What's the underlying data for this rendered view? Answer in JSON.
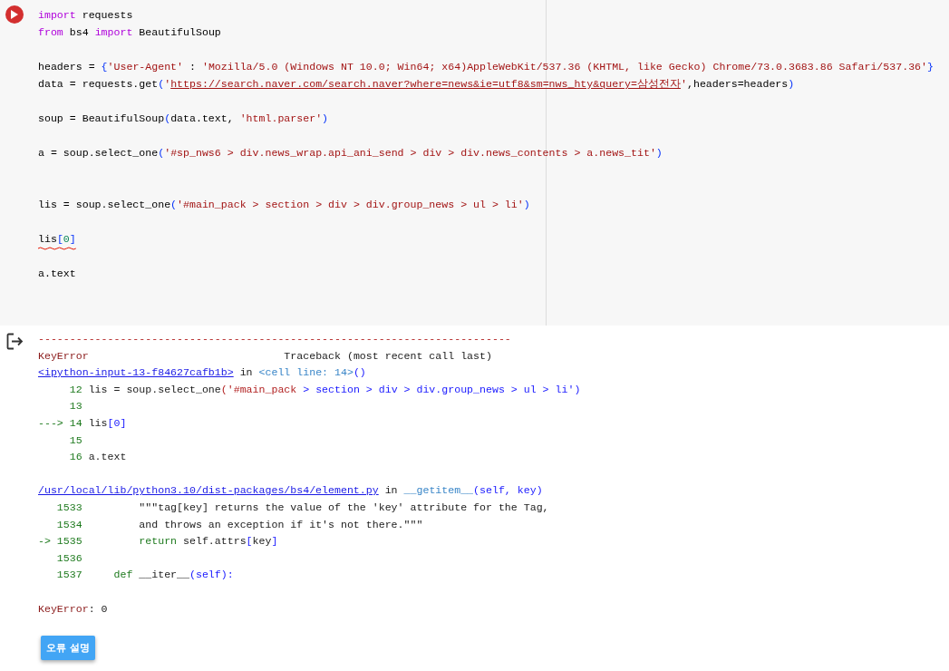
{
  "code_cell": {
    "blocks": [
      {
        "kind": "gap",
        "lines": [
          {
            "error": false,
            "tokens": [
              {
                "kind": "kw",
                "text": "import"
              },
              {
                "kind": "plain",
                "text": " requests"
              }
            ]
          },
          {
            "error": false,
            "tokens": [
              {
                "kind": "kw",
                "text": "from"
              },
              {
                "kind": "plain",
                "text": " bs4 "
              },
              {
                "kind": "kw",
                "text": "import"
              },
              {
                "kind": "plain",
                "text": " BeautifulSoup"
              }
            ]
          }
        ]
      },
      {
        "kind": "gap",
        "lines": [
          {
            "error": false,
            "tokens": [
              {
                "kind": "plain",
                "text": "headers = "
              },
              {
                "kind": "brk",
                "text": "{"
              },
              {
                "kind": "str",
                "text": "'User-Agent'"
              },
              {
                "kind": "plain",
                "text": " : "
              },
              {
                "kind": "str",
                "text": "'Mozilla/5.0 (Windows NT 10.0; Win64; x64)AppleWebKit/537.36 (KHTML, like Gecko) Chrome/73.0.3683.86 Safari/537.36'"
              },
              {
                "kind": "brk",
                "text": "}"
              }
            ]
          },
          {
            "error": false,
            "tokens": [
              {
                "kind": "plain",
                "text": "data = requests.get"
              },
              {
                "kind": "brk",
                "text": "("
              },
              {
                "kind": "str",
                "text": "'"
              },
              {
                "kind": "link",
                "text": "https://search.naver.com/search.naver?where=news&ie=utf8&sm=nws_hty&query=삼성전자"
              },
              {
                "kind": "str",
                "text": "'"
              },
              {
                "kind": "plain",
                "text": ",headers=headers"
              },
              {
                "kind": "brk",
                "text": ")"
              }
            ]
          }
        ]
      },
      {
        "kind": "gap",
        "lines": [
          {
            "error": false,
            "tokens": [
              {
                "kind": "plain",
                "text": "soup = BeautifulSoup"
              },
              {
                "kind": "brk",
                "text": "("
              },
              {
                "kind": "plain",
                "text": "data.text, "
              },
              {
                "kind": "str",
                "text": "'html.parser'"
              },
              {
                "kind": "brk",
                "text": ")"
              }
            ]
          }
        ]
      },
      {
        "kind": "double_gap",
        "lines": [
          {
            "error": false,
            "tokens": [
              {
                "kind": "plain",
                "text": "a = soup.select_one"
              },
              {
                "kind": "brk",
                "text": "("
              },
              {
                "kind": "str",
                "text": "'#sp_nws6 > div.news_wrap.api_ani_send > div > div.news_contents > a.news_tit'"
              },
              {
                "kind": "brk",
                "text": ")"
              }
            ]
          }
        ]
      },
      {
        "kind": "gap",
        "lines": [
          {
            "error": false,
            "tokens": [
              {
                "kind": "plain",
                "text": "lis = soup.select_one"
              },
              {
                "kind": "brk",
                "text": "("
              },
              {
                "kind": "str",
                "text": "'#main_pack > section > div > div.group_news > ul > li'"
              },
              {
                "kind": "brk",
                "text": ")"
              }
            ]
          }
        ]
      },
      {
        "kind": "gap",
        "lines": [
          {
            "error": true,
            "tokens": [
              {
                "kind": "plain",
                "text": "lis"
              },
              {
                "kind": "brk",
                "text": "["
              },
              {
                "kind": "num",
                "text": "0"
              },
              {
                "kind": "brk",
                "text": "]"
              }
            ]
          }
        ]
      },
      {
        "kind": "end",
        "lines": [
          {
            "error": false,
            "tokens": [
              {
                "kind": "plain",
                "text": "a.text"
              }
            ]
          }
        ]
      }
    ]
  },
  "output": {
    "blocks": [
      {
        "kind": "gap",
        "lines": [
          {
            "tokens": [
              {
                "kind": "err",
                "text": "---------------------------------------------------------------------------"
              }
            ]
          },
          {
            "tokens": [
              {
                "kind": "ename",
                "text": "KeyError"
              },
              {
                "kind": "plain",
                "text": "                               Traceback (most recent call last)"
              }
            ]
          },
          {
            "tokens": [
              {
                "kind": "link",
                "text": "<ipython-input-13-f84627cafb1b>"
              },
              {
                "kind": "plain",
                "text": " in "
              },
              {
                "kind": "func",
                "text": "<cell line: 14>"
              },
              {
                "kind": "brk",
                "text": "()"
              }
            ]
          },
          {
            "tokens": [
              {
                "kind": "ln",
                "text": "     12"
              },
              {
                "kind": "plain",
                "text": " lis = soup.select_one"
              },
              {
                "kind": "err",
                "text": "('#main_pack"
              },
              {
                "kind": "brk",
                "text": " > section > div > div.group_news > ul > li')"
              }
            ]
          },
          {
            "tokens": [
              {
                "kind": "ln",
                "text": "     13"
              }
            ]
          },
          {
            "tokens": [
              {
                "kind": "ln",
                "text": "---> 14"
              },
              {
                "kind": "plain",
                "text": " lis"
              },
              {
                "kind": "brk",
                "text": "[0]"
              }
            ]
          },
          {
            "tokens": [
              {
                "kind": "ln",
                "text": "     15"
              }
            ]
          },
          {
            "tokens": [
              {
                "kind": "ln",
                "text": "     16"
              },
              {
                "kind": "plain",
                "text": " a.text"
              }
            ]
          }
        ]
      },
      {
        "kind": "gap",
        "lines": [
          {
            "tokens": [
              {
                "kind": "link",
                "text": "/usr/local/lib/python3.10/dist-packages/bs4/element.py"
              },
              {
                "kind": "plain",
                "text": " in "
              },
              {
                "kind": "func",
                "text": "__getitem__"
              },
              {
                "kind": "brk",
                "text": "(self, key)"
              }
            ]
          },
          {
            "tokens": [
              {
                "kind": "ln",
                "text": "   1533"
              },
              {
                "kind": "plain",
                "text": "         \"\"\"tag[key] returns the value of the 'key' attribute for the Tag,"
              }
            ]
          },
          {
            "tokens": [
              {
                "kind": "ln",
                "text": "   1534"
              },
              {
                "kind": "plain",
                "text": "         and throws an exception if it's not there.\"\"\""
              }
            ]
          },
          {
            "tokens": [
              {
                "kind": "ln",
                "text": "-> 1535"
              },
              {
                "kind": "ln",
                "text": "         return"
              },
              {
                "kind": "plain",
                "text": " self.attrs"
              },
              {
                "kind": "brk",
                "text": "["
              },
              {
                "kind": "plain",
                "text": "key"
              },
              {
                "kind": "brk",
                "text": "]"
              }
            ]
          },
          {
            "tokens": [
              {
                "kind": "ln",
                "text": "   1536"
              }
            ]
          },
          {
            "tokens": [
              {
                "kind": "ln",
                "text": "   1537"
              },
              {
                "kind": "ln",
                "text": "     def"
              },
              {
                "kind": "plain",
                "text": " __iter__"
              },
              {
                "kind": "brk",
                "text": "(self):"
              }
            ]
          }
        ]
      },
      {
        "kind": "end",
        "lines": [
          {
            "tokens": [
              {
                "kind": "ename",
                "text": "KeyError"
              },
              {
                "kind": "plain",
                "text": ": 0"
              }
            ]
          }
        ]
      }
    ],
    "explain_button": "오류 설명"
  }
}
